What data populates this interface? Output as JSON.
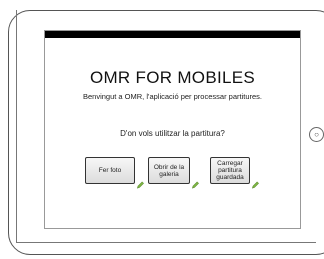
{
  "app": {
    "title": "OMR FOR MOBILES",
    "subtitle": "Benvingut a OMR, l'aplicació per processar partitures.",
    "question": "D'on vols utilitzar la partitura?"
  },
  "buttons": {
    "camera": "Fer foto",
    "gallery": "Obrir de la galeria",
    "saved": "Carregar partitura guardada"
  },
  "icons": {
    "edit": "pencil-icon",
    "home": "home-button"
  },
  "colors": {
    "pencil": "#7cb342",
    "topbar": "#000000"
  }
}
